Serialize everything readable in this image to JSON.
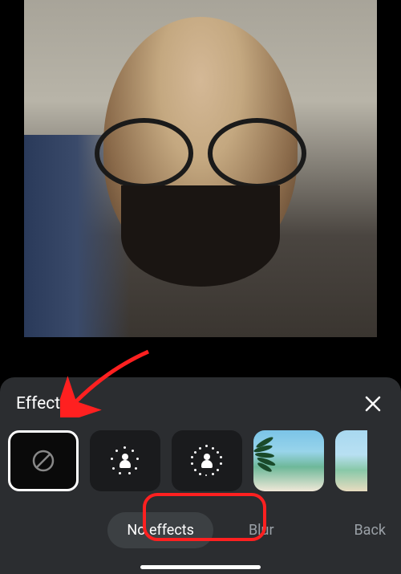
{
  "panel": {
    "title": "Effects"
  },
  "effects": {
    "tiles": [
      {
        "name": "no-effects",
        "selected": true,
        "icon": "prohibit"
      },
      {
        "name": "blur-light",
        "selected": false,
        "icon": "blur-person-light"
      },
      {
        "name": "blur-strong",
        "selected": false,
        "icon": "blur-person-strong"
      },
      {
        "name": "background-beach-1",
        "selected": false,
        "icon": "beach-image"
      },
      {
        "name": "background-beach-2",
        "selected": false,
        "icon": "beach-image"
      }
    ]
  },
  "labels": {
    "active": "No effects",
    "items": [
      {
        "text": "No effects",
        "active": true
      },
      {
        "text": "Blur",
        "active": false
      },
      {
        "text": "Back",
        "active": false
      }
    ]
  }
}
